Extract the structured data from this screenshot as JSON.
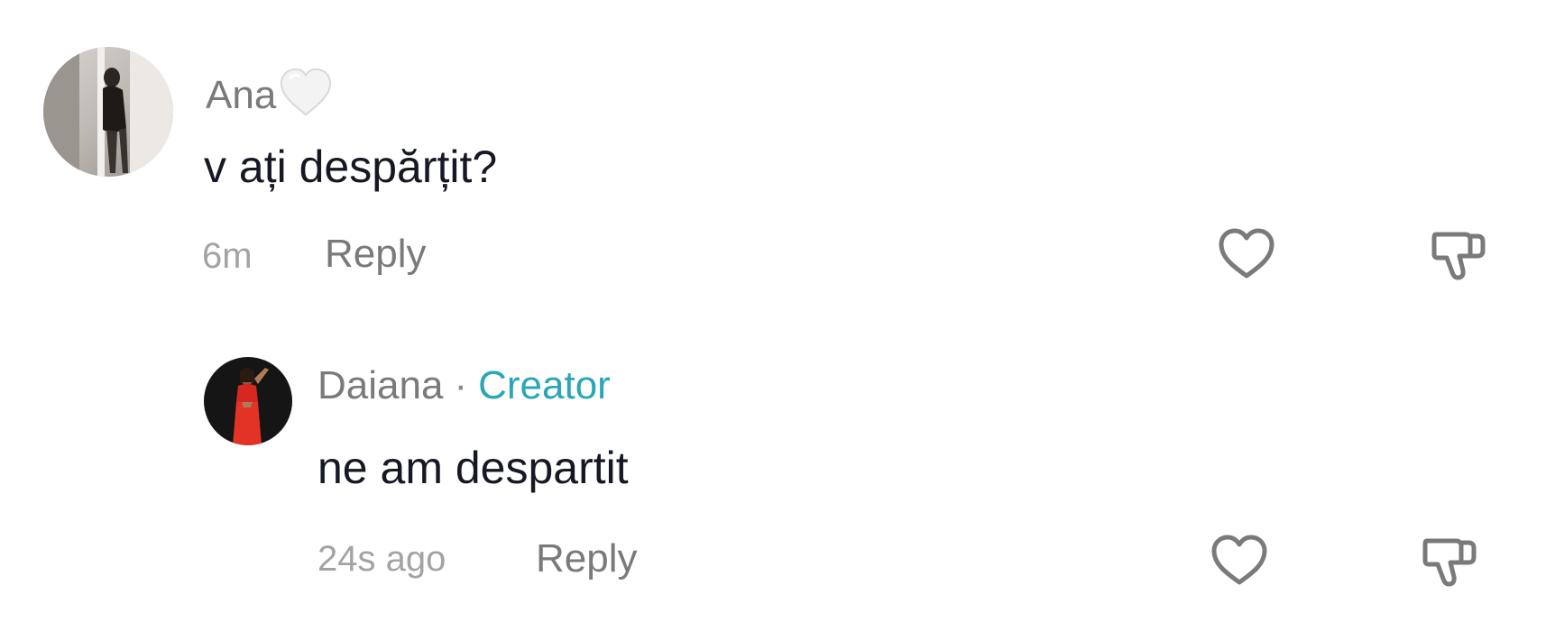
{
  "comments": [
    {
      "username": "Ana",
      "emoji": "white-heart-emoji",
      "text": "v ați despărțit?",
      "time": "6m",
      "reply_label": "Reply",
      "like_icon": "heart-outline-icon",
      "dislike_icon": "thumbs-down-icon"
    },
    {
      "username": "Daiana",
      "separator": "·",
      "badge": "Creator",
      "text": "ne am despartit",
      "time": "24s ago",
      "reply_label": "Reply",
      "like_icon": "heart-outline-icon",
      "dislike_icon": "thumbs-down-icon"
    }
  ],
  "colors": {
    "username": "#7a7a7a",
    "text": "#161823",
    "meta": "#a3a3a3",
    "creator_badge": "#2aa6b8",
    "icon_stroke": "#7a7a7a"
  }
}
